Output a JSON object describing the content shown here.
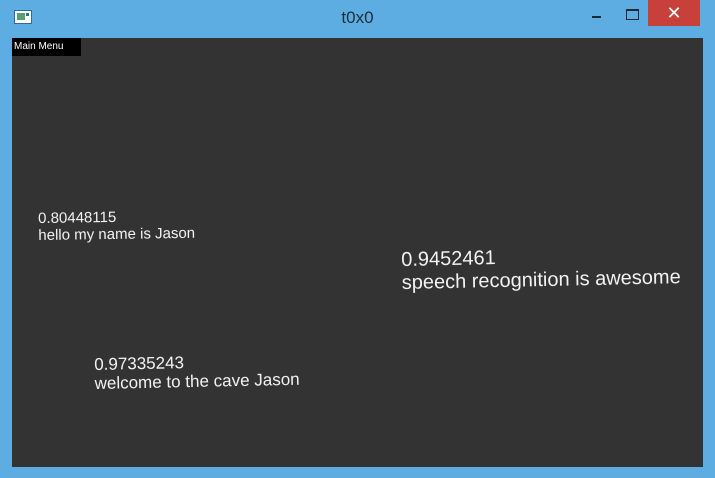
{
  "window": {
    "title": "t0x0",
    "close_glyph": "✕",
    "icons": [
      "app-icon",
      "minimize-icon",
      "maximize-icon",
      "close-icon"
    ]
  },
  "menu": {
    "main_menu_label": "Main Menu"
  },
  "results": [
    {
      "confidence": "0.80448115",
      "text": "hello my name is Jason"
    },
    {
      "confidence": "0.9452461",
      "text": "speech recognition is awesome"
    },
    {
      "confidence": "0.97335243",
      "text": "welcome to the cave Jason"
    }
  ],
  "colors": {
    "frame": "#5dade2",
    "canvas": "#333333",
    "text": "#f2f2f2",
    "close": "#c7413a",
    "menu_bg": "#000000"
  }
}
